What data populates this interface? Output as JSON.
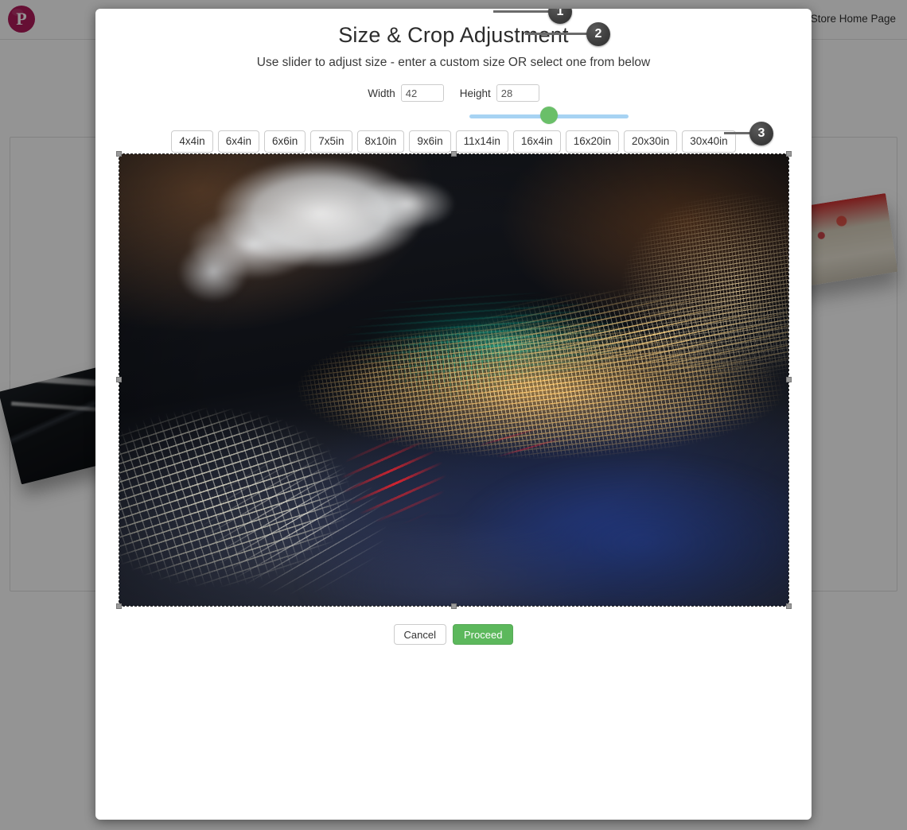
{
  "background_page": {
    "logo_letter": "P",
    "logo_color": "#b01a5b",
    "store_home_link": "Store Home Page"
  },
  "modal": {
    "title": "Size & Crop Adjustment",
    "subtitle": "Use slider to adjust size - enter a custom size OR select one from below",
    "size_inputs": {
      "width_label": "Width",
      "width_value": "42",
      "height_label": "Height",
      "height_value": "28"
    },
    "slider": {
      "thumb_color": "#6abf69",
      "track_color": "#a7d3f3",
      "position_percent": 45
    },
    "presets": [
      {
        "label": "4x4in"
      },
      {
        "label": "6x4in"
      },
      {
        "label": "6x6in"
      },
      {
        "label": "7x5in"
      },
      {
        "label": "8x10in"
      },
      {
        "label": "9x6in"
      },
      {
        "label": "11x14in"
      },
      {
        "label": "16x4in"
      },
      {
        "label": "16x20in"
      },
      {
        "label": "20x30in"
      },
      {
        "label": "30x40in"
      }
    ],
    "callouts": [
      {
        "number": "1"
      },
      {
        "number": "2"
      },
      {
        "number": "3"
      }
    ],
    "crop_area": {
      "description": "Long-exposure night photograph of city light trails - white blur at top left, teal streaks in the middle, dense gold and red light trails across the center, deep blue haze at lower right"
    },
    "footer": {
      "cancel_label": "Cancel",
      "proceed_label": "Proceed",
      "proceed_color": "#5cb85c"
    }
  }
}
